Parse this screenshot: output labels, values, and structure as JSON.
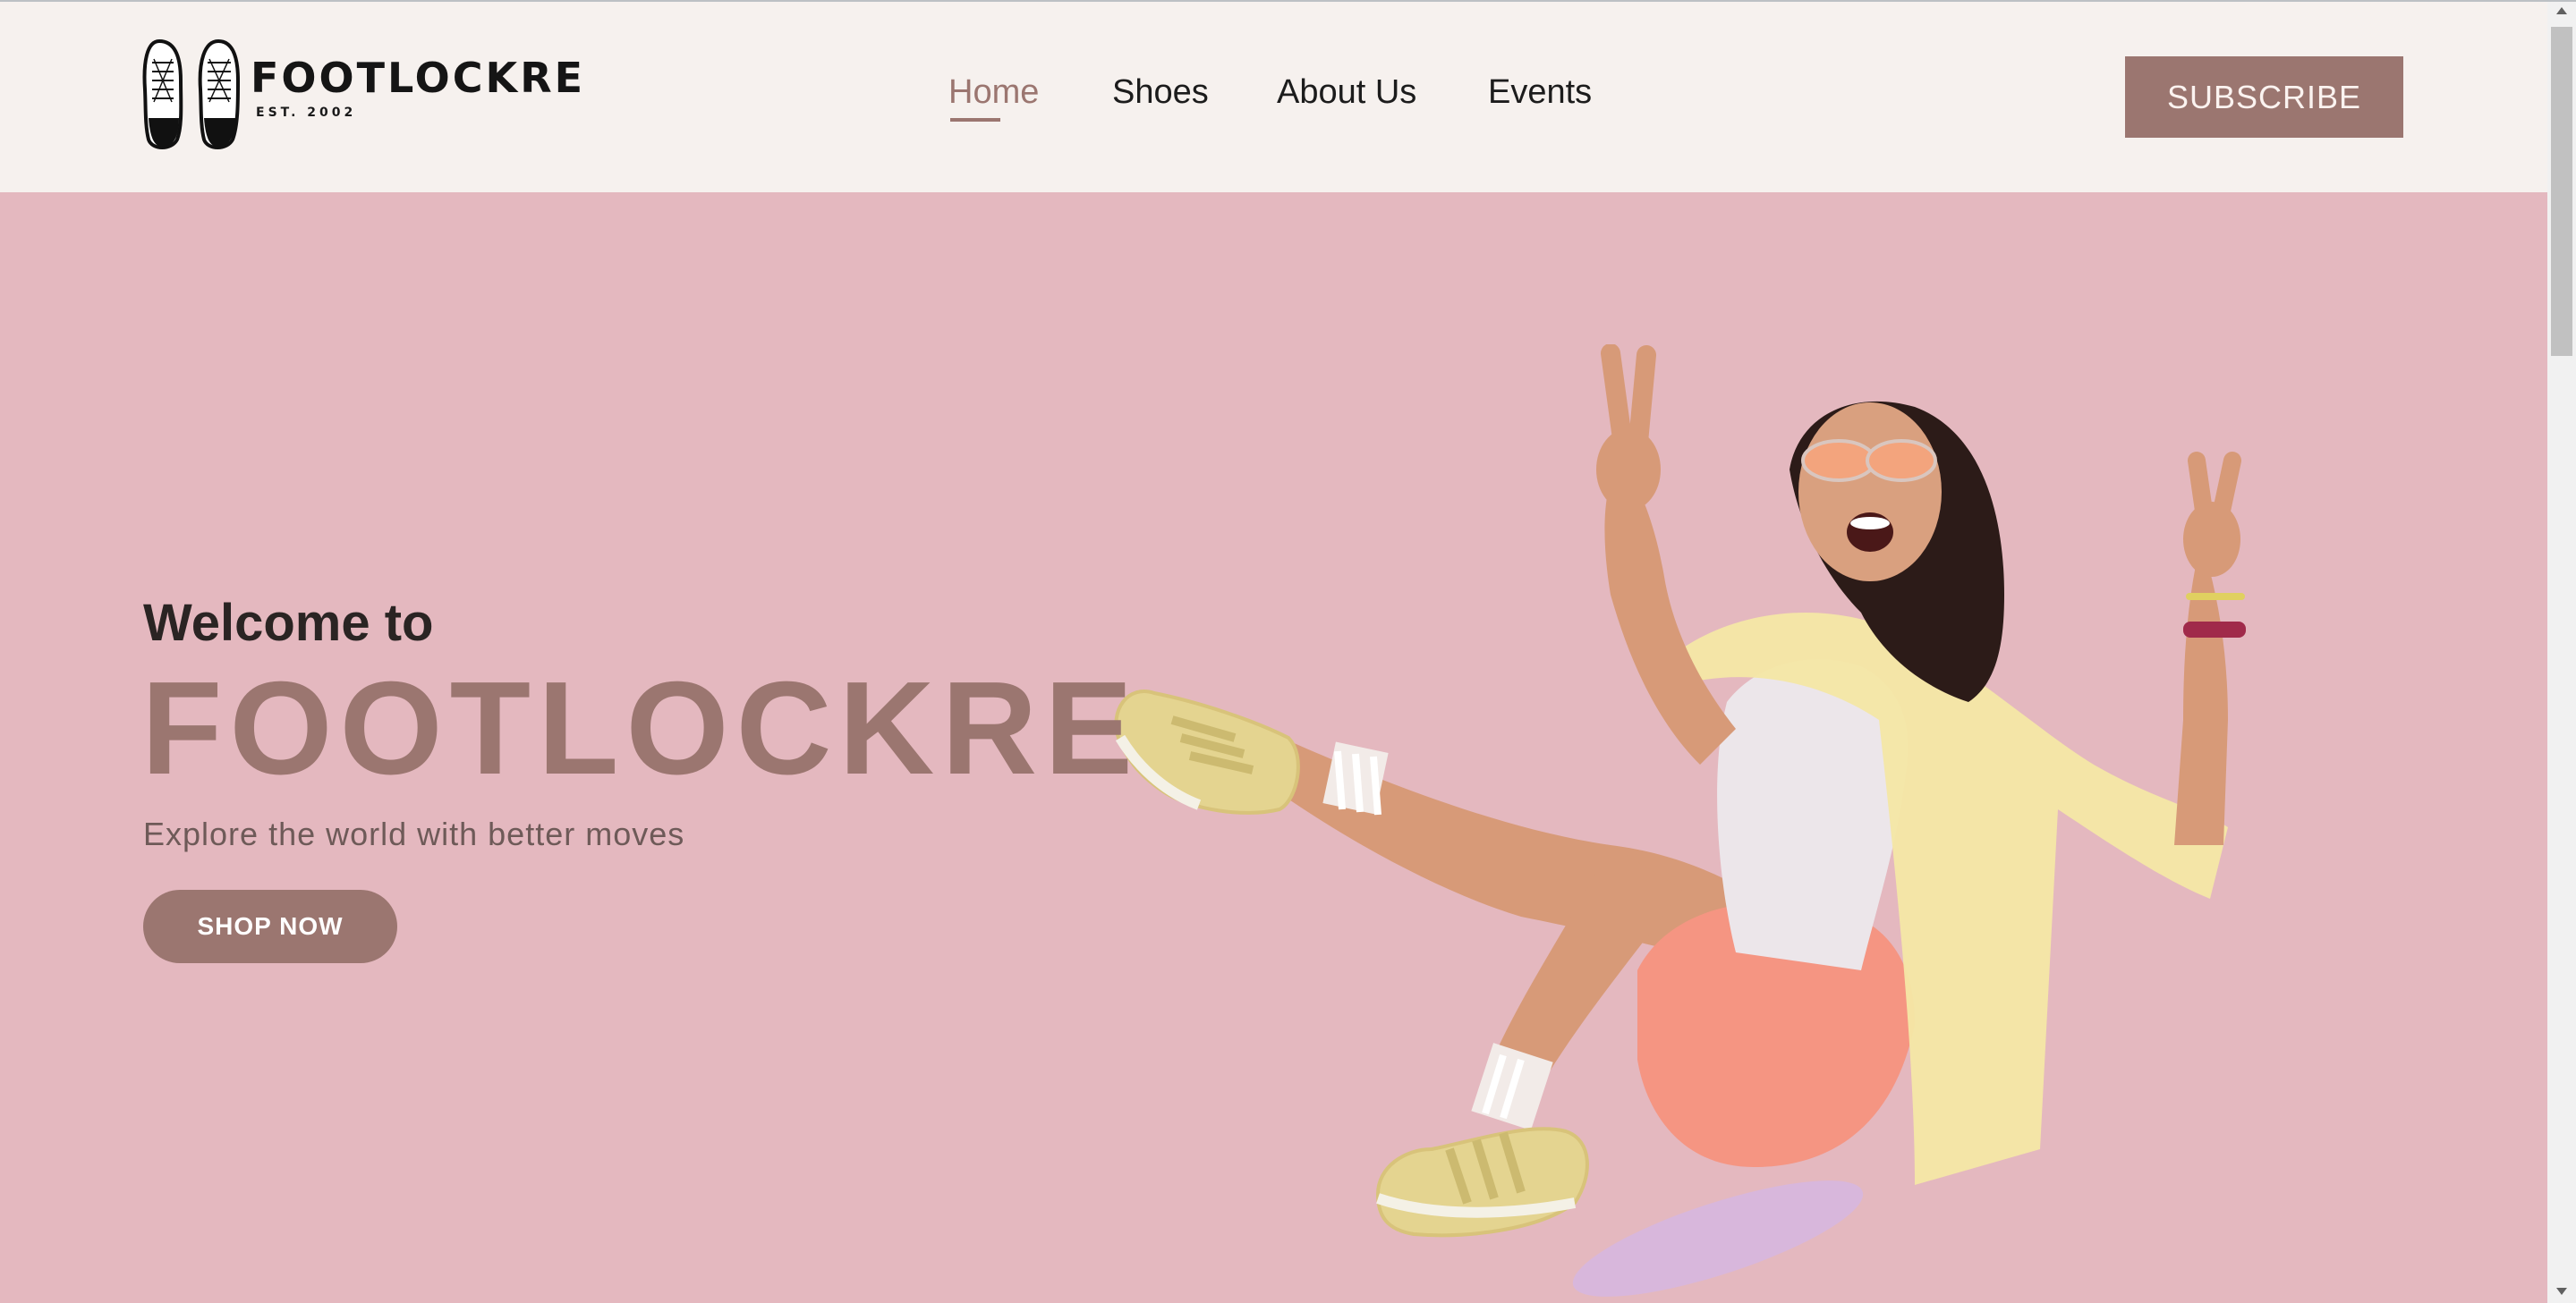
{
  "header": {
    "logo": {
      "text": "FOOTLOCKRE",
      "subtext": "EST. 2002"
    },
    "nav": [
      {
        "label": "Home",
        "active": true
      },
      {
        "label": "Shoes",
        "active": false
      },
      {
        "label": "About Us",
        "active": false
      },
      {
        "label": "Events",
        "active": false
      }
    ],
    "subscribe_label": "SUBSCRIBE"
  },
  "hero": {
    "welcome": "Welcome to",
    "brand": "FOOTLOCKRE",
    "tagline": "Explore the world with better moves",
    "cta_label": "SHOP NOW"
  },
  "colors": {
    "accent": "#9b7670",
    "header_bg": "#f6f1ee",
    "hero_bg": "#e4b8bf"
  }
}
